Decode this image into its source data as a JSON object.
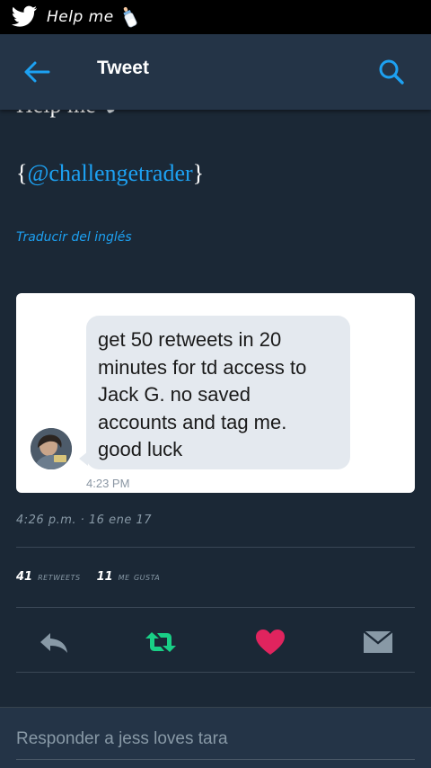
{
  "status_bar": {
    "text": "Help me",
    "icons": [
      "twitter-bird-icon",
      "baby-bottle-icon"
    ]
  },
  "header": {
    "title": "Tweet",
    "icons": [
      "back-arrow-icon",
      "search-icon"
    ]
  },
  "tweet": {
    "top_text": "Help me",
    "mention_prefix": "{",
    "mention": "@challengetrader",
    "mention_suffix": "}",
    "translate_label": "Traducir del inglés"
  },
  "embedded_image": {
    "message_lines": [
      "get 50 retweets in 20",
      "minutes for td access to",
      "Jack G. no saved",
      "accounts and tag me.",
      "good luck"
    ],
    "message_time": "4:23 PM"
  },
  "meta": {
    "timestamp": "4:26 p.m. · 16 ene 17",
    "retweets_count": "41",
    "retweets_label": "retweets",
    "likes_count": "11",
    "likes_label": "me gusta"
  },
  "actions": {
    "icons": [
      "reply-icon",
      "retweet-icon",
      "heart-icon",
      "message-icon"
    ],
    "colors": {
      "retweet": "#19cf86",
      "heart": "#e0245e",
      "neutral": "#8899a6"
    }
  },
  "reply": {
    "placeholder": "Responder a jess loves tara"
  },
  "colors": {
    "background": "#1b2836",
    "header": "#243447",
    "accent": "#1da1f2"
  }
}
